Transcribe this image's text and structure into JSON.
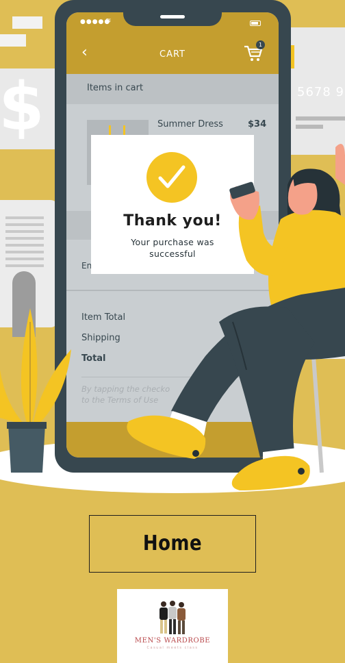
{
  "cart_screen": {
    "title": "CART",
    "badge_count": "1",
    "items_label": "Items in cart",
    "product_name": "Summer Dress",
    "product_price": "$34",
    "email_label": "En",
    "item_total_label": "Item Total",
    "shipping_label": "Shipping",
    "total_label": "Total",
    "terms_line1": "By tapping the checko",
    "terms_line2": "to the Terms of Use"
  },
  "background": {
    "dollar_sign": "$",
    "card_number": "5678  9"
  },
  "modal": {
    "title": "Thank you!",
    "message": "Your purchase was successful"
  },
  "home_button": {
    "label": "Home"
  },
  "logo": {
    "name": "MEN'S WARDROBE",
    "tagline": "Casual meets class"
  },
  "colors": {
    "background": "#dfbe55",
    "accent_yellow": "#f4c423",
    "phone_dark": "#37474f",
    "header_gold": "#c49e2f",
    "logo_red": "#b8474a"
  }
}
